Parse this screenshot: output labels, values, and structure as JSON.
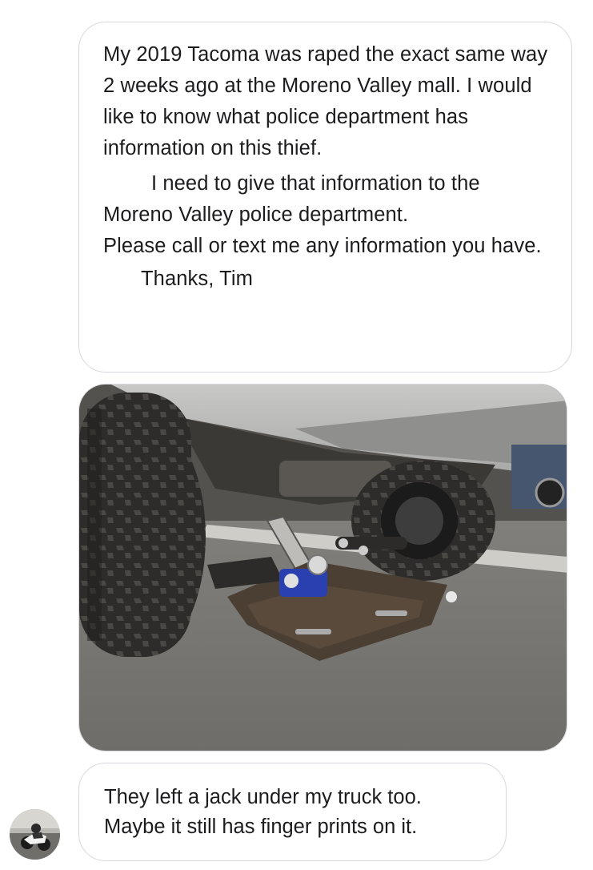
{
  "messages": [
    {
      "lines": [
        "My 2019 Tacoma was raped the exact same way 2 weeks ago at the Moreno Valley mall.  I would like to know what police department has information on this thief.",
        "I need to give that information to the Moreno Valley police department.",
        "Please call or text me any information you have.",
        "Thanks, Tim"
      ]
    },
    {
      "lines": [
        "They left a jack under my truck too.",
        "Maybe it still has finger prints on it."
      ]
    }
  ],
  "photo": {
    "icon": "truck-underside-photo"
  },
  "avatar": {
    "icon": "motorcycle-rider-avatar"
  },
  "colors": {
    "bubble_border": "#d8d8dc",
    "text": "#1c1c1e",
    "background": "#ffffff"
  }
}
